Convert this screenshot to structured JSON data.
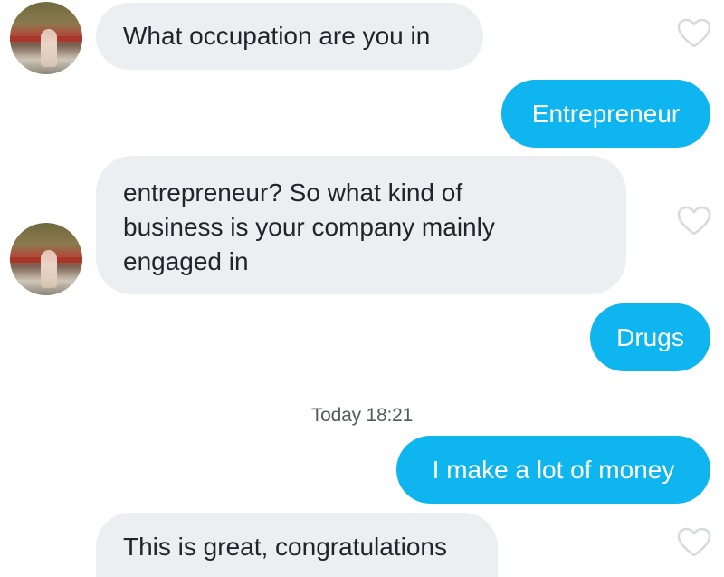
{
  "conversation": {
    "messages": [
      {
        "sender": "other",
        "text": "What occupation are you in",
        "liked": false
      },
      {
        "sender": "me",
        "text": "Entrepreneur"
      },
      {
        "sender": "other",
        "text": "entrepreneur? So what kind of\nbusiness is your company mainly\nengaged in",
        "liked": false
      },
      {
        "sender": "me",
        "text": "Drugs"
      },
      {
        "sender": "me",
        "text": "I make a lot of money"
      },
      {
        "sender": "other",
        "text": "This is great, congratulations",
        "liked": false
      }
    ],
    "timestamp": "Today 18:21"
  },
  "colors": {
    "outgoing_bubble": "#0fb5ee",
    "incoming_bubble": "#eceef1",
    "heart_outline": "#d7d9dc"
  },
  "icons": {
    "like": "heart-outline-icon",
    "avatar": "profile-avatar"
  }
}
